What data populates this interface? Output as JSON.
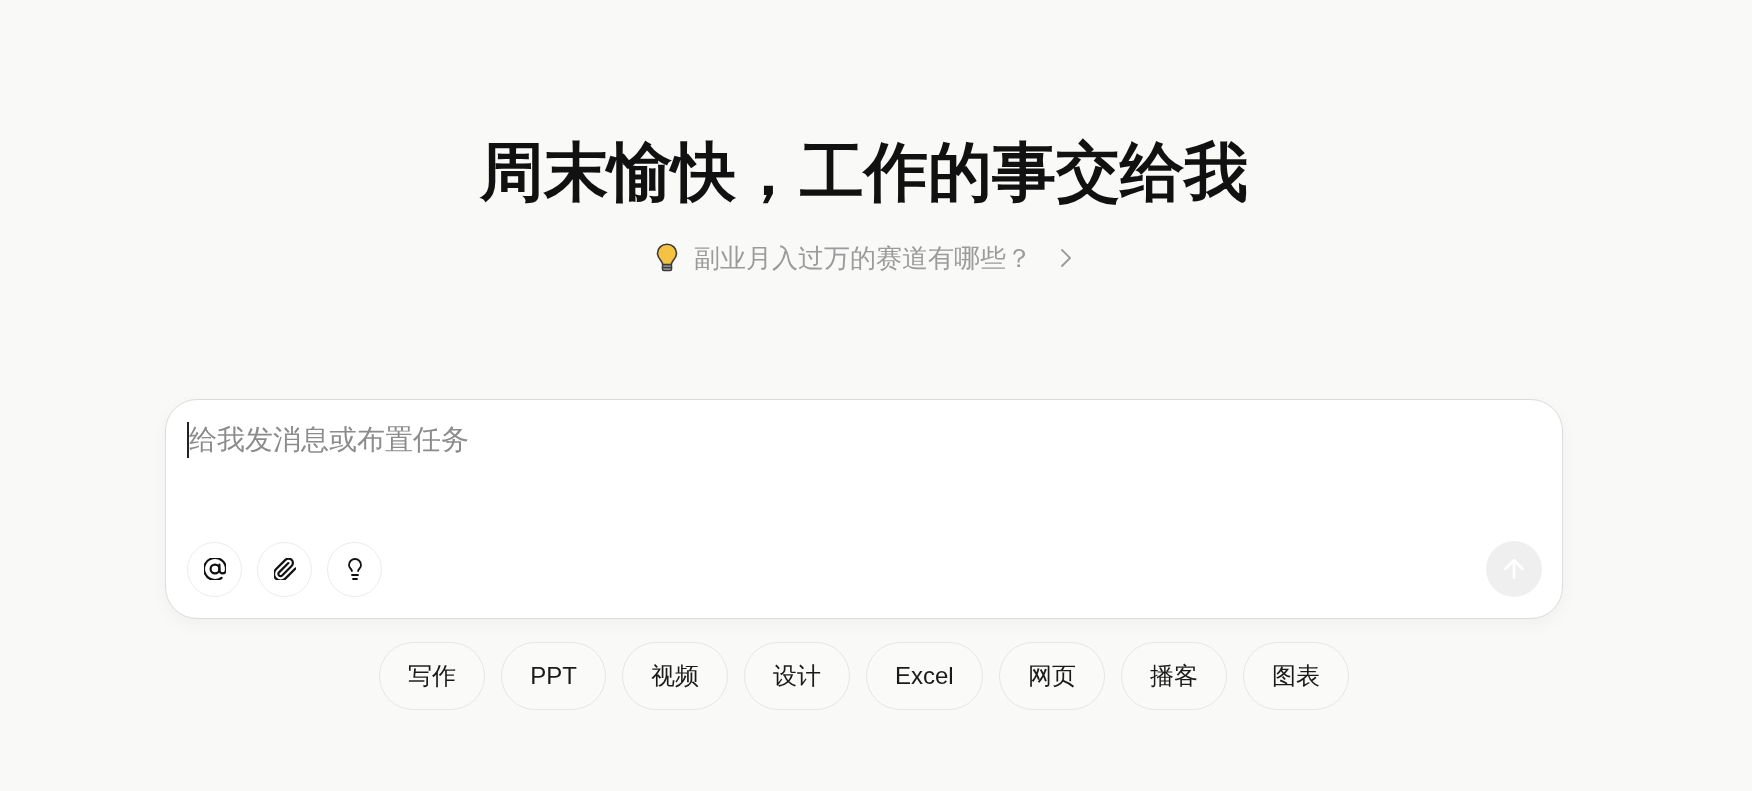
{
  "heading": {
    "title": "周末愉快，工作的事交给我"
  },
  "suggestion": {
    "text": "副业月入过万的赛道有哪些？"
  },
  "composer": {
    "placeholder": "给我发消息或布置任务",
    "focused": true,
    "tools": [
      {
        "kind": "mention"
      },
      {
        "kind": "attach"
      },
      {
        "kind": "idea"
      }
    ],
    "send": {
      "disabled": true
    }
  },
  "quick_actions": [
    {
      "label": "写作"
    },
    {
      "label": "PPT"
    },
    {
      "label": "视频"
    },
    {
      "label": "设计"
    },
    {
      "label": "Excel"
    },
    {
      "label": "网页"
    },
    {
      "label": "播客"
    },
    {
      "label": "图表"
    }
  ]
}
